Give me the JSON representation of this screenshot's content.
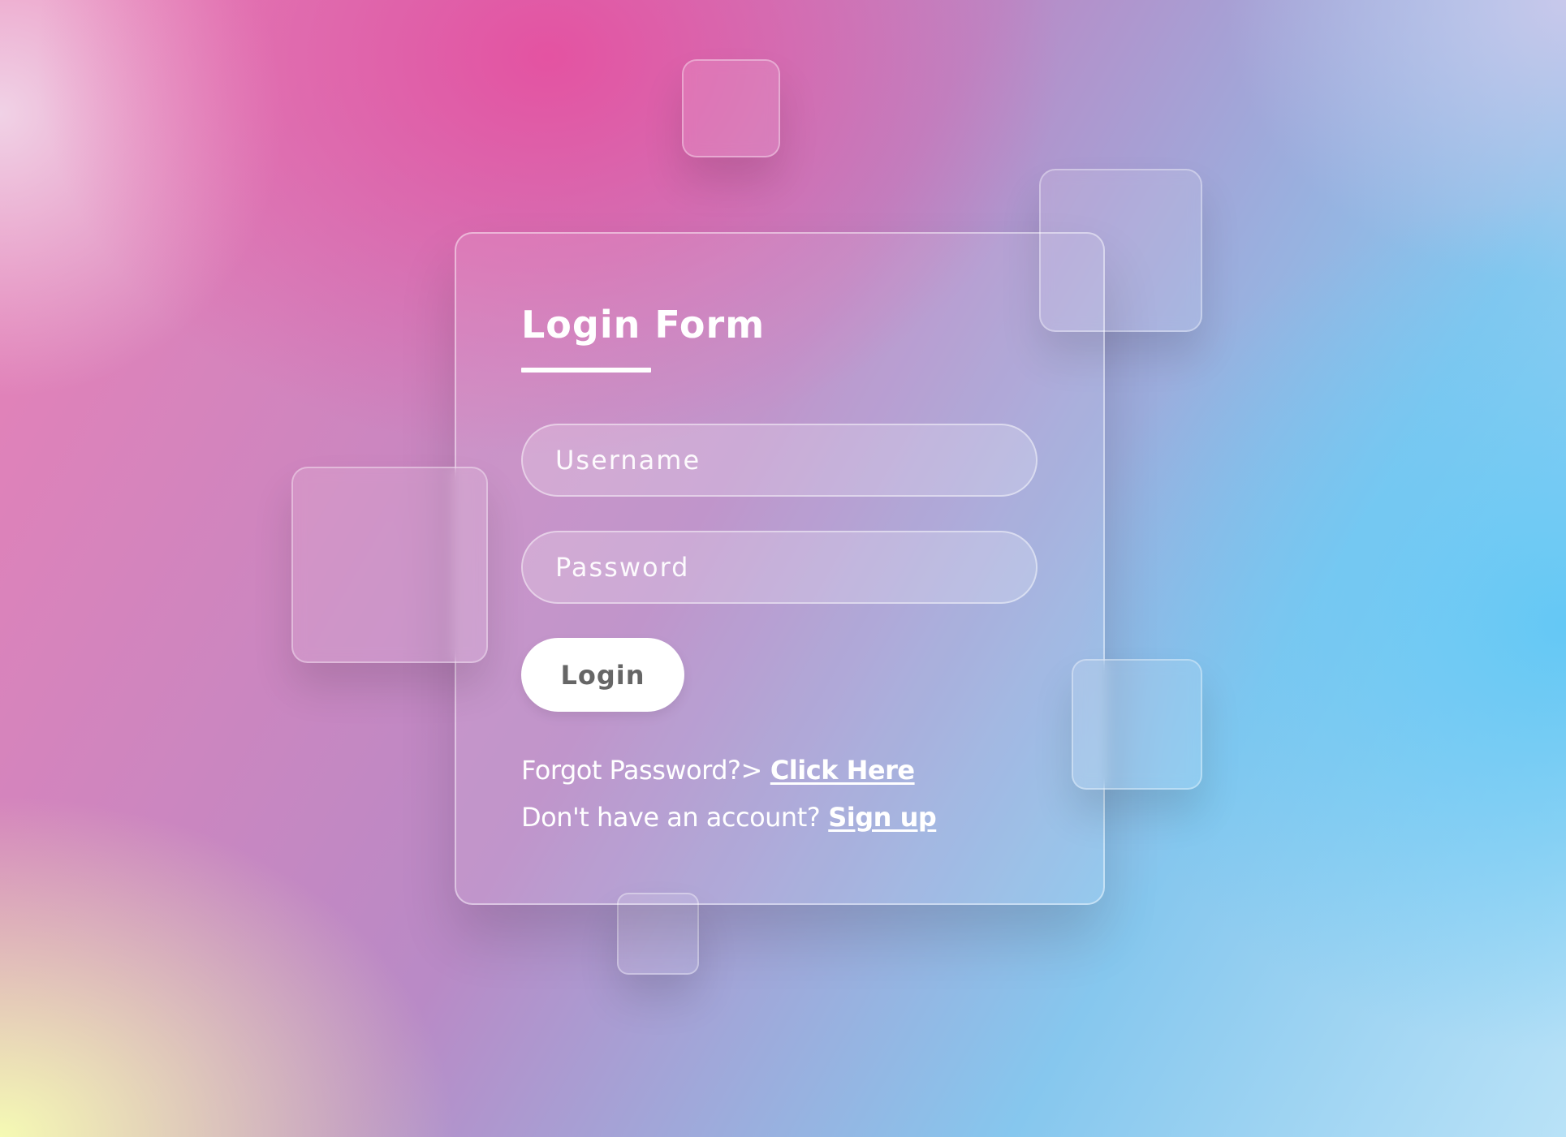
{
  "form": {
    "title": "Login Form",
    "username_placeholder": "Username",
    "password_placeholder": "Password",
    "login_label": "Login",
    "forgot_text": "Forgot Password?>",
    "forgot_link": "Click Here",
    "signup_text": "Don't have an account?",
    "signup_link": "Sign up"
  },
  "colors": {
    "pink": "#e550a0",
    "blue": "#64c8f5",
    "yellow": "#f5fab4",
    "button_bg": "#ffffff",
    "button_text": "#666666"
  }
}
